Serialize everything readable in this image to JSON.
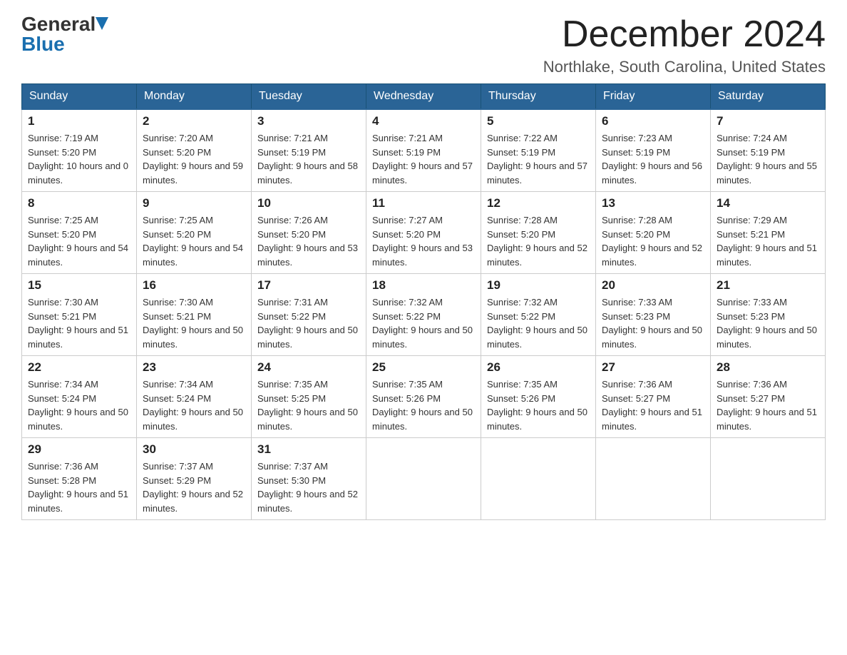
{
  "header": {
    "logo": {
      "general": "General",
      "blue": "Blue",
      "aria": "GeneralBlue logo"
    },
    "month_title": "December 2024",
    "location": "Northlake, South Carolina, United States"
  },
  "days_of_week": [
    "Sunday",
    "Monday",
    "Tuesday",
    "Wednesday",
    "Thursday",
    "Friday",
    "Saturday"
  ],
  "weeks": [
    [
      {
        "day": "1",
        "sunrise": "7:19 AM",
        "sunset": "5:20 PM",
        "daylight": "10 hours and 0 minutes."
      },
      {
        "day": "2",
        "sunrise": "7:20 AM",
        "sunset": "5:20 PM",
        "daylight": "9 hours and 59 minutes."
      },
      {
        "day": "3",
        "sunrise": "7:21 AM",
        "sunset": "5:19 PM",
        "daylight": "9 hours and 58 minutes."
      },
      {
        "day": "4",
        "sunrise": "7:21 AM",
        "sunset": "5:19 PM",
        "daylight": "9 hours and 57 minutes."
      },
      {
        "day": "5",
        "sunrise": "7:22 AM",
        "sunset": "5:19 PM",
        "daylight": "9 hours and 57 minutes."
      },
      {
        "day": "6",
        "sunrise": "7:23 AM",
        "sunset": "5:19 PM",
        "daylight": "9 hours and 56 minutes."
      },
      {
        "day": "7",
        "sunrise": "7:24 AM",
        "sunset": "5:19 PM",
        "daylight": "9 hours and 55 minutes."
      }
    ],
    [
      {
        "day": "8",
        "sunrise": "7:25 AM",
        "sunset": "5:20 PM",
        "daylight": "9 hours and 54 minutes."
      },
      {
        "day": "9",
        "sunrise": "7:25 AM",
        "sunset": "5:20 PM",
        "daylight": "9 hours and 54 minutes."
      },
      {
        "day": "10",
        "sunrise": "7:26 AM",
        "sunset": "5:20 PM",
        "daylight": "9 hours and 53 minutes."
      },
      {
        "day": "11",
        "sunrise": "7:27 AM",
        "sunset": "5:20 PM",
        "daylight": "9 hours and 53 minutes."
      },
      {
        "day": "12",
        "sunrise": "7:28 AM",
        "sunset": "5:20 PM",
        "daylight": "9 hours and 52 minutes."
      },
      {
        "day": "13",
        "sunrise": "7:28 AM",
        "sunset": "5:20 PM",
        "daylight": "9 hours and 52 minutes."
      },
      {
        "day": "14",
        "sunrise": "7:29 AM",
        "sunset": "5:21 PM",
        "daylight": "9 hours and 51 minutes."
      }
    ],
    [
      {
        "day": "15",
        "sunrise": "7:30 AM",
        "sunset": "5:21 PM",
        "daylight": "9 hours and 51 minutes."
      },
      {
        "day": "16",
        "sunrise": "7:30 AM",
        "sunset": "5:21 PM",
        "daylight": "9 hours and 50 minutes."
      },
      {
        "day": "17",
        "sunrise": "7:31 AM",
        "sunset": "5:22 PM",
        "daylight": "9 hours and 50 minutes."
      },
      {
        "day": "18",
        "sunrise": "7:32 AM",
        "sunset": "5:22 PM",
        "daylight": "9 hours and 50 minutes."
      },
      {
        "day": "19",
        "sunrise": "7:32 AM",
        "sunset": "5:22 PM",
        "daylight": "9 hours and 50 minutes."
      },
      {
        "day": "20",
        "sunrise": "7:33 AM",
        "sunset": "5:23 PM",
        "daylight": "9 hours and 50 minutes."
      },
      {
        "day": "21",
        "sunrise": "7:33 AM",
        "sunset": "5:23 PM",
        "daylight": "9 hours and 50 minutes."
      }
    ],
    [
      {
        "day": "22",
        "sunrise": "7:34 AM",
        "sunset": "5:24 PM",
        "daylight": "9 hours and 50 minutes."
      },
      {
        "day": "23",
        "sunrise": "7:34 AM",
        "sunset": "5:24 PM",
        "daylight": "9 hours and 50 minutes."
      },
      {
        "day": "24",
        "sunrise": "7:35 AM",
        "sunset": "5:25 PM",
        "daylight": "9 hours and 50 minutes."
      },
      {
        "day": "25",
        "sunrise": "7:35 AM",
        "sunset": "5:26 PM",
        "daylight": "9 hours and 50 minutes."
      },
      {
        "day": "26",
        "sunrise": "7:35 AM",
        "sunset": "5:26 PM",
        "daylight": "9 hours and 50 minutes."
      },
      {
        "day": "27",
        "sunrise": "7:36 AM",
        "sunset": "5:27 PM",
        "daylight": "9 hours and 51 minutes."
      },
      {
        "day": "28",
        "sunrise": "7:36 AM",
        "sunset": "5:27 PM",
        "daylight": "9 hours and 51 minutes."
      }
    ],
    [
      {
        "day": "29",
        "sunrise": "7:36 AM",
        "sunset": "5:28 PM",
        "daylight": "9 hours and 51 minutes."
      },
      {
        "day": "30",
        "sunrise": "7:37 AM",
        "sunset": "5:29 PM",
        "daylight": "9 hours and 52 minutes."
      },
      {
        "day": "31",
        "sunrise": "7:37 AM",
        "sunset": "5:30 PM",
        "daylight": "9 hours and 52 minutes."
      },
      null,
      null,
      null,
      null
    ]
  ]
}
